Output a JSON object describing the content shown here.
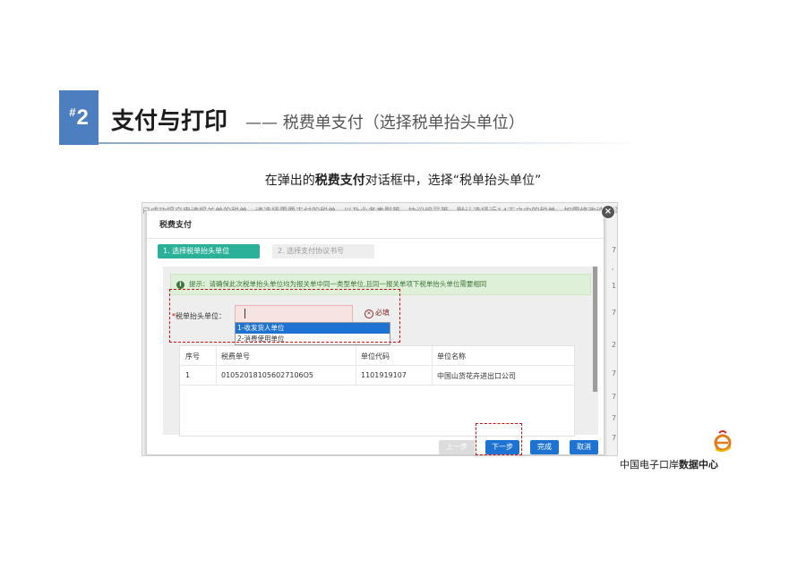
{
  "header": {
    "badge_prefix": "#",
    "badge_number": "2",
    "title": "支付与打印",
    "subtitle": "—— 税费单支付（选择税单抬头单位）"
  },
  "caption": {
    "part1": "在弹出的",
    "bold": "税费支付",
    "part2": "对话框中，选择“税单抬头单位”"
  },
  "screenshot": {
    "background_text": "已成功提交申请报关单的税单，请选择需要支付的税单，以及业务类型等，协议编号等，默认选择近14天之内的税单，如需修改请选择",
    "right_edge_chars": [
      "7",
      "'",
      "1",
      "7",
      "2",
      "7",
      "7",
      "7",
      "7"
    ],
    "dialog": {
      "title": "税费支付",
      "close_glyph": "×",
      "steps": [
        "1. 选择税单抬头单位",
        "2. 选择支付协议书号"
      ],
      "notice_icon": "i",
      "notice": "提示：请确保此次税单抬头单位均为报关单中同一类型单位,且同一报关单项下税单抬头单位需要相同",
      "form": {
        "required_star": "*",
        "label": "税单抬头单位：",
        "input_value": "",
        "required_icon": "✕",
        "required_text": "必填",
        "options": [
          "1-收发货人单位",
          "2-消费使用单位"
        ],
        "selected_index": 0
      },
      "table": {
        "headers": [
          "序号",
          "税费单号",
          "单位代码",
          "单位名称"
        ],
        "rows": [
          [
            "1",
            "010520181056027106O5",
            "1101919107",
            "中国山货花卉进出口公司"
          ]
        ]
      },
      "buttons": {
        "prev": "上一步",
        "next": "下一步",
        "done": "完成",
        "cancel": "取消"
      }
    }
  },
  "brand": {
    "name_regular": "中国电子口岸",
    "name_bold": "数据中心"
  },
  "colors": {
    "accent_blue": "#4d7fc0",
    "step_active": "#2bb09a",
    "button_blue": "#1e73d2",
    "highlight_dash": "#d01010"
  }
}
